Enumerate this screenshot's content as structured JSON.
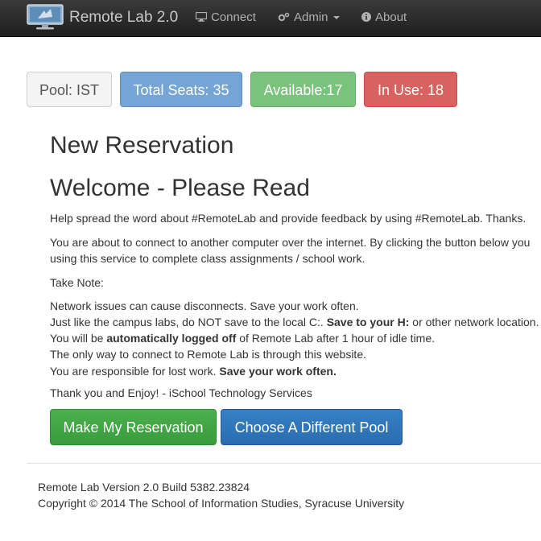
{
  "navbar": {
    "logo_icon": "monitor-logo-icon",
    "brand": "Remote Lab 2.0",
    "connect": {
      "label": "Connect",
      "icon": "desktop-icon"
    },
    "admin": {
      "label": "Admin",
      "icon": "gears-icon"
    },
    "about": {
      "label": "About",
      "icon": "info-circle-icon"
    }
  },
  "pool": {
    "pool_label": "Pool: IST",
    "total_seats": "Total Seats: 35",
    "available": "Available:17",
    "in_use": "In Use: 18"
  },
  "main": {
    "heading": "New Reservation",
    "welcome": "Welcome - Please Read",
    "spread_word": "Help spread the word about #RemoteLab and provide feedback by using #RemoteLab.  Thanks.",
    "about_line1": "You are about to connect to another computer over the internet. By clicking the button below you",
    "about_line2": "using this service to complete class assignments / school work.",
    "take_note": "Take Note:",
    "note1": "Network issues can cause disconnects. Save your work often.",
    "note2_a": "Just like the campus labs, do NOT save to the local C:. ",
    "note2_b": "Save to your H:",
    "note2_c": " or other network location.",
    "note3_a": "You will be ",
    "note3_b": "automatically logged off",
    "note3_c": " of Remote Lab after 1 hour of idle time.",
    "note4": "The only way to connect to Remote Lab is through this website.",
    "note5_a": "You are responsible for lost work. ",
    "note5_b": "Save your work often.",
    "thanks": "Thank you and Enjoy! - iSchool Technology Services",
    "reserve_button": "Make My Reservation",
    "pool_button": "Choose A Different Pool"
  },
  "footer": {
    "version": "Remote Lab Version 2.0 Build 5382.23824",
    "copyright": "Copyright © 2014 The School of Information Studies, Syracuse University"
  },
  "colors": {
    "navbar": "#2b2b2b",
    "total_seats": "#74a5d6",
    "available": "#7ac37c",
    "in_use": "#d7625f",
    "reserve_button": "#3fa442",
    "pool_button": "#2f76ba"
  }
}
